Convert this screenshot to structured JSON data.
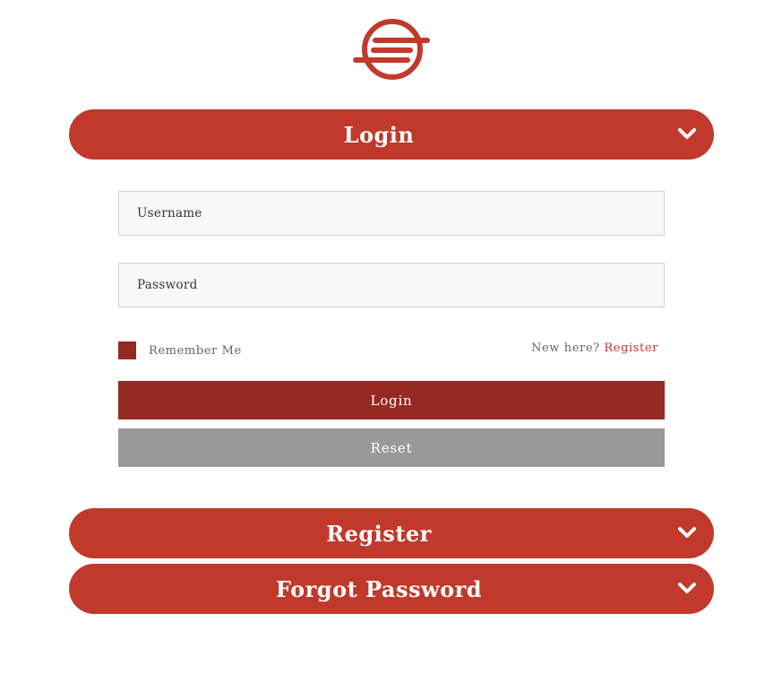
{
  "brand": {
    "logo_icon": "circle-stripes-logo-icon",
    "accent_color": "#c0392b"
  },
  "login_section": {
    "title": "Login",
    "username_placeholder": "Username",
    "password_placeholder": "Password",
    "remember_label": "Remember Me",
    "new_here_text": "New here?",
    "register_link": "Register",
    "login_button": "Login",
    "reset_button": "Reset"
  },
  "register_section": {
    "title": "Register"
  },
  "forgot_section": {
    "title": "Forgot Password"
  },
  "icons": {
    "accordion_toggle": "chevron-down-icon"
  }
}
